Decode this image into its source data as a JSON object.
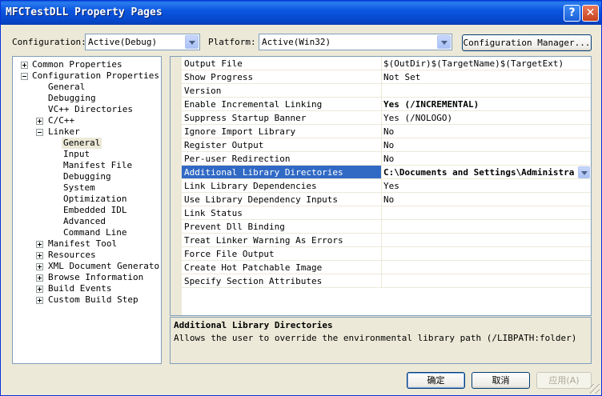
{
  "window": {
    "title": "MFCTestDLL Property Pages"
  },
  "config": {
    "configuration_label": "Configuration:",
    "configuration_value": "Active(Debug)",
    "platform_label": "Platform:",
    "platform_value": "Active(Win32)",
    "manager_button": "Configuration Manager..."
  },
  "tree": {
    "items": [
      {
        "label": "Common Properties"
      },
      {
        "label": "Configuration Properties"
      },
      {
        "label": "General"
      },
      {
        "label": "Debugging"
      },
      {
        "label": "VC++ Directories"
      },
      {
        "label": "C/C++"
      },
      {
        "label": "Linker"
      },
      {
        "label": "General"
      },
      {
        "label": "Input"
      },
      {
        "label": "Manifest File"
      },
      {
        "label": "Debugging"
      },
      {
        "label": "System"
      },
      {
        "label": "Optimization"
      },
      {
        "label": "Embedded IDL"
      },
      {
        "label": "Advanced"
      },
      {
        "label": "Command Line"
      },
      {
        "label": "Manifest Tool"
      },
      {
        "label": "Resources"
      },
      {
        "label": "XML Document Generator"
      },
      {
        "label": "Browse Information"
      },
      {
        "label": "Build Events"
      },
      {
        "label": "Custom Build Step"
      }
    ]
  },
  "grid": {
    "rows": [
      {
        "name": "Output File",
        "value": "$(OutDir)$(TargetName)$(TargetExt)"
      },
      {
        "name": "Show Progress",
        "value": "Not Set"
      },
      {
        "name": "Version",
        "value": ""
      },
      {
        "name": "Enable Incremental Linking",
        "value": "Yes (/INCREMENTAL)"
      },
      {
        "name": "Suppress Startup Banner",
        "value": "Yes (/NOLOGO)"
      },
      {
        "name": "Ignore Import Library",
        "value": "No"
      },
      {
        "name": "Register Output",
        "value": "No"
      },
      {
        "name": "Per-user Redirection",
        "value": "No"
      },
      {
        "name": "Additional Library Directories",
        "value": "C:\\Documents and Settings\\Administra"
      },
      {
        "name": "Link Library Dependencies",
        "value": "Yes"
      },
      {
        "name": "Use Library Dependency Inputs",
        "value": "No"
      },
      {
        "name": "Link Status",
        "value": ""
      },
      {
        "name": "Prevent Dll Binding",
        "value": ""
      },
      {
        "name": "Treat Linker Warning As Errors",
        "value": ""
      },
      {
        "name": "Force File Output",
        "value": ""
      },
      {
        "name": "Create Hot Patchable Image",
        "value": ""
      },
      {
        "name": "Specify Section Attributes",
        "value": ""
      }
    ]
  },
  "description": {
    "title": "Additional Library Directories",
    "text": "Allows the user to override the environmental library path (/LIBPATH:folder)"
  },
  "buttons": {
    "ok": "确定",
    "cancel": "取消",
    "apply": "应用(A)"
  },
  "colors": {
    "selection": "#316ac5",
    "titlebar": "#0546c9",
    "dialog_bg": "#ece9d8"
  }
}
